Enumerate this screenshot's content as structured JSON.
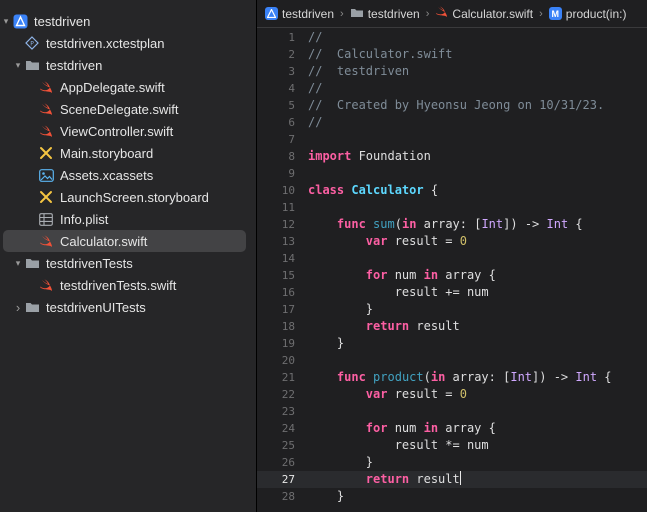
{
  "navigator": {
    "items": [
      {
        "label": "testdriven",
        "icon": "project-icon",
        "chevron": "▾",
        "indent": 0,
        "selected": false
      },
      {
        "label": "testdriven.xctestplan",
        "icon": "testplan-icon",
        "chevron": "",
        "indent": 1,
        "selected": false
      },
      {
        "label": "testdriven",
        "icon": "folder-icon",
        "chevron": "▾",
        "indent": 1,
        "selected": false
      },
      {
        "label": "AppDelegate.swift",
        "icon": "swift-icon",
        "chevron": "",
        "indent": 2,
        "selected": false
      },
      {
        "label": "SceneDelegate.swift",
        "icon": "swift-icon",
        "chevron": "",
        "indent": 2,
        "selected": false
      },
      {
        "label": "ViewController.swift",
        "icon": "swift-icon",
        "chevron": "",
        "indent": 2,
        "selected": false
      },
      {
        "label": "Main.storyboard",
        "icon": "storyboard-icon",
        "chevron": "",
        "indent": 2,
        "selected": false
      },
      {
        "label": "Assets.xcassets",
        "icon": "assets-icon",
        "chevron": "",
        "indent": 2,
        "selected": false
      },
      {
        "label": "LaunchScreen.storyboard",
        "icon": "storyboard-icon",
        "chevron": "",
        "indent": 2,
        "selected": false
      },
      {
        "label": "Info.plist",
        "icon": "plist-icon",
        "chevron": "",
        "indent": 2,
        "selected": false
      },
      {
        "label": "Calculator.swift",
        "icon": "swift-icon",
        "chevron": "",
        "indent": 2,
        "selected": true
      },
      {
        "label": "testdrivenTests",
        "icon": "folder-icon",
        "chevron": "▾",
        "indent": 1,
        "selected": false
      },
      {
        "label": "testdrivenTests.swift",
        "icon": "swift-icon",
        "chevron": "",
        "indent": 2,
        "selected": false
      },
      {
        "label": "testdrivenUITests",
        "icon": "folder-icon",
        "chevron": "›",
        "indent": 1,
        "selected": false
      }
    ]
  },
  "jumpbar": {
    "project": "testdriven",
    "group": "testdriven",
    "file": "Calculator.swift",
    "symbol_badge": "M",
    "symbol": "product(in:)",
    "separator": "›"
  },
  "editor": {
    "current_line": 27,
    "lines": [
      [
        {
          "t": "//",
          "c": "cm"
        }
      ],
      [
        {
          "t": "//  Calculator.swift",
          "c": "cm"
        }
      ],
      [
        {
          "t": "//  testdriven",
          "c": "cm"
        }
      ],
      [
        {
          "t": "//",
          "c": "cm"
        }
      ],
      [
        {
          "t": "//  Created by Hyeonsu Jeong on 10/31/23.",
          "c": "cm"
        }
      ],
      [
        {
          "t": "//",
          "c": "cm"
        }
      ],
      [],
      [
        {
          "t": "import",
          "c": "kw"
        },
        {
          "t": " Foundation",
          "c": "pl"
        }
      ],
      [],
      [
        {
          "t": "class",
          "c": "kw"
        },
        {
          "t": " ",
          "c": "pl"
        },
        {
          "t": "Calculator",
          "c": "ty"
        },
        {
          "t": " {",
          "c": "pl"
        }
      ],
      [],
      [
        {
          "t": "    ",
          "c": "pl"
        },
        {
          "t": "func",
          "c": "kw"
        },
        {
          "t": " ",
          "c": "pl"
        },
        {
          "t": "sum",
          "c": "fn"
        },
        {
          "t": "(",
          "c": "pl"
        },
        {
          "t": "in",
          "c": "kw"
        },
        {
          "t": " array: [",
          "c": "pl"
        },
        {
          "t": "Int",
          "c": "ot"
        },
        {
          "t": "]) -> ",
          "c": "pl"
        },
        {
          "t": "Int",
          "c": "ot"
        },
        {
          "t": " {",
          "c": "pl"
        }
      ],
      [
        {
          "t": "        ",
          "c": "pl"
        },
        {
          "t": "var",
          "c": "kw"
        },
        {
          "t": " result = ",
          "c": "pl"
        },
        {
          "t": "0",
          "c": "nm"
        }
      ],
      [],
      [
        {
          "t": "        ",
          "c": "pl"
        },
        {
          "t": "for",
          "c": "kw"
        },
        {
          "t": " num ",
          "c": "pl"
        },
        {
          "t": "in",
          "c": "kw"
        },
        {
          "t": " array {",
          "c": "pl"
        }
      ],
      [
        {
          "t": "            result += num",
          "c": "pl"
        }
      ],
      [
        {
          "t": "        }",
          "c": "pl"
        }
      ],
      [
        {
          "t": "        ",
          "c": "pl"
        },
        {
          "t": "return",
          "c": "kw"
        },
        {
          "t": " result",
          "c": "pl"
        }
      ],
      [
        {
          "t": "    }",
          "c": "pl"
        }
      ],
      [],
      [
        {
          "t": "    ",
          "c": "pl"
        },
        {
          "t": "func",
          "c": "kw"
        },
        {
          "t": " ",
          "c": "pl"
        },
        {
          "t": "product",
          "c": "fn"
        },
        {
          "t": "(",
          "c": "pl"
        },
        {
          "t": "in",
          "c": "kw"
        },
        {
          "t": " array: [",
          "c": "pl"
        },
        {
          "t": "Int",
          "c": "ot"
        },
        {
          "t": "]) -> ",
          "c": "pl"
        },
        {
          "t": "Int",
          "c": "ot"
        },
        {
          "t": " {",
          "c": "pl"
        }
      ],
      [
        {
          "t": "        ",
          "c": "pl"
        },
        {
          "t": "var",
          "c": "kw"
        },
        {
          "t": " result = ",
          "c": "pl"
        },
        {
          "t": "0",
          "c": "nm"
        }
      ],
      [],
      [
        {
          "t": "        ",
          "c": "pl"
        },
        {
          "t": "for",
          "c": "kw"
        },
        {
          "t": " num ",
          "c": "pl"
        },
        {
          "t": "in",
          "c": "kw"
        },
        {
          "t": " array {",
          "c": "pl"
        }
      ],
      [
        {
          "t": "            result *= num",
          "c": "pl"
        }
      ],
      [
        {
          "t": "        }",
          "c": "pl"
        }
      ],
      [
        {
          "t": "        ",
          "c": "pl"
        },
        {
          "t": "return",
          "c": "kw"
        },
        {
          "t": " result",
          "c": "pl"
        }
      ],
      [
        {
          "t": "    }",
          "c": "pl"
        }
      ]
    ]
  },
  "colors": {
    "comment": "#7f8c98",
    "keyword": "#fc5fa3",
    "type_decl": "#5dd8ff",
    "func_decl": "#41a1c0",
    "other_type": "#d0a8ff",
    "number": "#d0bf69",
    "plain": "#dfdfe0",
    "swift": "#f05138",
    "folder": "#9aa0a6",
    "accent": "#3a82f7",
    "storyboard": "#f5c542"
  }
}
